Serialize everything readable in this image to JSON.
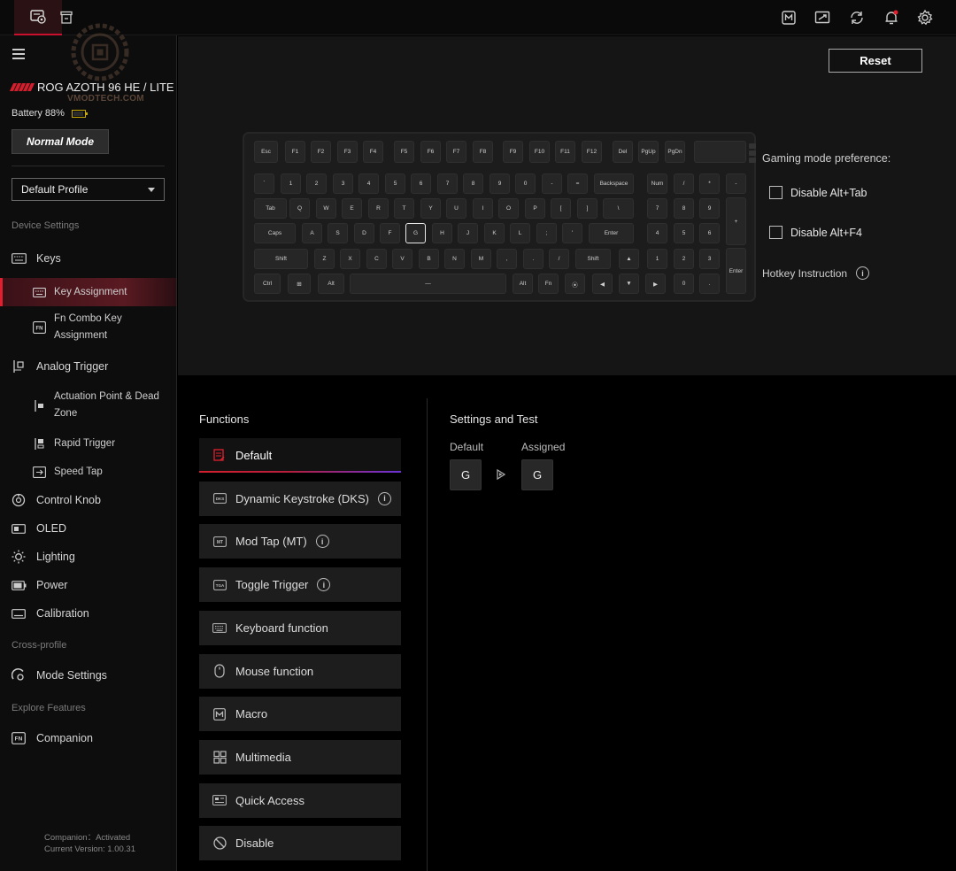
{
  "device": {
    "name": "ROG AZOTH 96 HE / LITE",
    "battery": "Battery 88%",
    "mode": "Normal Mode",
    "profile": "Default Profile",
    "watermark": "VMODTECH.COM"
  },
  "sidebar": {
    "device_settings_label": "Device Settings",
    "keys": "Keys",
    "key_assignment": "Key Assignment",
    "fn_combo": "Fn Combo Key Assignment",
    "analog_trigger": "Analog Trigger",
    "actuation": "Actuation Point & Dead Zone",
    "rapid_trigger": "Rapid Trigger",
    "speed_tap": "Speed Tap",
    "control_knob": "Control Knob",
    "oled": "OLED",
    "lighting": "Lighting",
    "power": "Power",
    "calibration": "Calibration",
    "cross_profile_label": "Cross-profile",
    "mode_settings": "Mode Settings",
    "explore_label": "Explore Features",
    "companion": "Companion",
    "companion_status": "Companion：Activated",
    "version": "Current Version: 1.00.31"
  },
  "keyboard_panel": {
    "reset": "Reset",
    "gaming_pref": "Gaming mode preference:",
    "disable_alt_tab": "Disable Alt+Tab",
    "disable_alt_f4": "Disable Alt+F4",
    "hotkey_instruction": "Hotkey Instruction",
    "info": "i",
    "rows": [
      [
        [
          "Esc",
          285,
          27
        ],
        [
          "F1",
          320,
          23
        ],
        [
          "F2",
          349,
          23
        ],
        [
          "F3",
          379,
          23
        ],
        [
          "F4",
          408,
          23
        ],
        [
          "F5",
          443,
          23
        ],
        [
          "F6",
          473,
          23
        ],
        [
          "F7",
          502,
          23
        ],
        [
          "F8",
          532,
          23
        ],
        [
          "F9",
          566,
          23
        ],
        [
          "F10",
          596,
          23
        ],
        [
          "F11",
          625,
          23
        ],
        [
          "F12",
          655,
          23
        ],
        [
          "Del",
          690,
          23
        ],
        [
          "PgUp",
          719,
          23
        ],
        [
          "PgDn",
          749,
          23
        ],
        [
          "",
          782,
          59
        ]
      ],
      [
        [
          "`",
          285,
          23
        ],
        [
          "1",
          315,
          23
        ],
        [
          "2",
          344,
          23
        ],
        [
          "3",
          374,
          23
        ],
        [
          "4",
          403,
          23
        ],
        [
          "5",
          433,
          23
        ],
        [
          "6",
          462,
          23
        ],
        [
          "7",
          492,
          23
        ],
        [
          "8",
          521,
          23
        ],
        [
          "9",
          551,
          23
        ],
        [
          "0",
          580,
          23
        ],
        [
          "-",
          610,
          23
        ],
        [
          "=",
          639,
          23
        ],
        [
          "Backspace",
          669,
          45
        ],
        [
          "Num",
          729,
          23
        ],
        [
          "/",
          759,
          23
        ],
        [
          "*",
          788,
          23
        ],
        [
          "-",
          818,
          23
        ]
      ],
      [
        [
          "Tab",
          285,
          37
        ],
        [
          "Q",
          325,
          23
        ],
        [
          "W",
          355,
          23
        ],
        [
          "E",
          384,
          23
        ],
        [
          "R",
          414,
          23
        ],
        [
          "T",
          443,
          23
        ],
        [
          "Y",
          473,
          23
        ],
        [
          "U",
          502,
          23
        ],
        [
          "I",
          532,
          23
        ],
        [
          "O",
          561,
          23
        ],
        [
          "P",
          591,
          23
        ],
        [
          "[",
          620,
          23
        ],
        [
          "]",
          650,
          23
        ],
        [
          "\\",
          679,
          35
        ],
        [
          "7",
          729,
          23
        ],
        [
          "8",
          759,
          23
        ],
        [
          "9",
          788,
          23
        ]
      ],
      [
        [
          "Caps",
          285,
          47
        ],
        [
          "A",
          339,
          23
        ],
        [
          "S",
          368,
          23
        ],
        [
          "D",
          398,
          23
        ],
        [
          "F",
          427,
          23
        ],
        [
          "G",
          456,
          23
        ],
        [
          "H",
          486,
          23
        ],
        [
          "J",
          515,
          23
        ],
        [
          "K",
          545,
          23
        ],
        [
          "L",
          574,
          23
        ],
        [
          ";",
          604,
          23
        ],
        [
          "'",
          633,
          23
        ],
        [
          "Enter",
          663,
          51
        ],
        [
          "4",
          729,
          23
        ],
        [
          "5",
          759,
          23
        ],
        [
          "6",
          788,
          23
        ]
      ],
      [
        [
          "Shift",
          285,
          61
        ],
        [
          "Z",
          353,
          23
        ],
        [
          "X",
          382,
          23
        ],
        [
          "C",
          412,
          23
        ],
        [
          "V",
          441,
          23
        ],
        [
          "B",
          471,
          23
        ],
        [
          "N",
          500,
          23
        ],
        [
          "M",
          530,
          23
        ],
        [
          ",",
          559,
          23
        ],
        [
          ".",
          589,
          23
        ],
        [
          "/",
          618,
          23
        ],
        [
          "Shift",
          648,
          40
        ],
        [
          "▲",
          697,
          23
        ],
        [
          "1",
          729,
          23
        ],
        [
          "2",
          759,
          23
        ],
        [
          "3",
          788,
          23
        ]
      ],
      [
        [
          "Ctrl",
          285,
          30
        ],
        [
          "⊞",
          323,
          26
        ],
        [
          "Alt",
          357,
          30
        ],
        [
          "—",
          393,
          177
        ],
        [
          "Alt",
          577,
          23
        ],
        [
          "Fn",
          606,
          23
        ],
        [
          "⦿",
          636,
          23
        ],
        [
          "◀",
          667,
          23
        ],
        [
          "▼",
          697,
          23
        ],
        [
          "▶",
          727,
          23
        ],
        [
          "0",
          759,
          23
        ],
        [
          ".",
          788,
          23
        ]
      ]
    ],
    "tall": [
      [
        "+",
        818,
        221,
        54
      ],
      [
        "Enter",
        818,
        278,
        52
      ]
    ],
    "selected_key": "G"
  },
  "functions": {
    "title": "Functions",
    "items": [
      "Default",
      "Dynamic Keystroke (DKS)",
      "Mod Tap (MT)",
      "Toggle Trigger",
      "Keyboard function",
      "Mouse function",
      "Macro",
      "Multimedia",
      "Quick Access",
      "Disable"
    ]
  },
  "settings_test": {
    "title": "Settings and Test",
    "default_label": "Default",
    "assigned_label": "Assigned",
    "default_key": "G",
    "assigned_key": "G"
  },
  "colors": {
    "accent": "#d31f2d",
    "gradient_end": "#6a32d8"
  }
}
